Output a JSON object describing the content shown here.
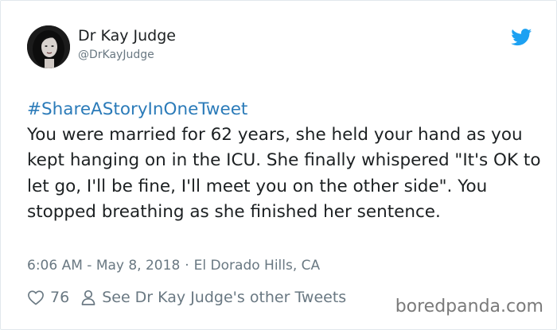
{
  "author": {
    "display_name": "Dr Kay Judge",
    "screen_name": "@DrKayJudge",
    "avatar_icon": "profile-photo"
  },
  "brand": {
    "icon": "twitter-bird-icon",
    "color": "#1da1f2"
  },
  "tweet": {
    "hashtag": "#ShareAStoryInOneTweet",
    "text": "You were married for 62 years, she held your hand as you kept hanging on in the ICU. She finally whispered \"It's OK to let go, I'll be fine, I'll meet you on the other side\". You stopped breathing as she finished her sentence.",
    "time": "6:06 AM - May 8, 2018",
    "separator": "·",
    "location": "El Dorado Hills, CA"
  },
  "actions": {
    "like_icon": "heart-icon",
    "like_count": "76",
    "profile_icon": "person-icon",
    "profile_link": "See Dr Kay Judge's other Tweets"
  },
  "watermark": {
    "text": "boredpanda.com"
  },
  "colors": {
    "text": "#1c2022",
    "secondary": "#697882",
    "link": "#2b7bb9"
  }
}
